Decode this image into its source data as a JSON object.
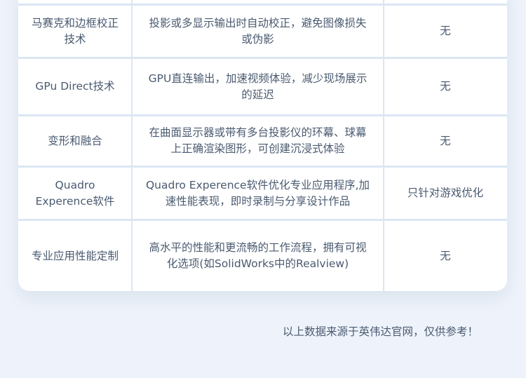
{
  "table": {
    "rows": [
      {
        "feature": "马赛克和边框校正技术",
        "description": "投影或多显示输出时自动校正，避免图像损失或伪影",
        "other": "无"
      },
      {
        "feature": "GPu Direct技术",
        "description": "GPU直连输出，加速视频体验，减少现场展示的延迟",
        "other": "无"
      },
      {
        "feature": "变形和融合",
        "description": "在曲面显示器或带有多台投影仪的环幕、球幕上正确渲染图形，可创建沉浸式体验",
        "other": "无"
      },
      {
        "feature": "Quadro Experence软件",
        "description": "Quadro Experence软件优化专业应用程序,加速性能表现，即时录制与分享设计作品",
        "other": "只针对游戏优化"
      },
      {
        "feature": "专业应用性能定制",
        "description": "高水平的性能和更流畅的工作流程，拥有可视化选项(如SolidWorks中的Realview)",
        "other": "无"
      }
    ]
  },
  "footer": {
    "note": "以上数据来源于英伟达官网，仅供参考！"
  },
  "colors": {
    "background": "#eef3fb",
    "card": "#ffffff",
    "grid": "#dbe6f3",
    "text": "#4a5a70"
  }
}
